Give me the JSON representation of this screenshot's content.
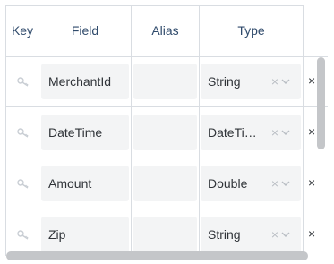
{
  "header": {
    "key": "Key",
    "field": "Field",
    "alias": "Alias",
    "type": "Type"
  },
  "rows": [
    {
      "field": "MerchantId",
      "alias": "",
      "type": "String"
    },
    {
      "field": "DateTime",
      "alias": "",
      "type": "DateTi…"
    },
    {
      "field": "Amount",
      "alias": "",
      "type": "Double"
    },
    {
      "field": "Zip",
      "alias": "",
      "type": "String"
    }
  ],
  "icons": {
    "key": "key-icon",
    "clear": "×",
    "dropdown": "chevron-down-icon",
    "delete": "×"
  },
  "colors": {
    "header_text": "#2f4a6b",
    "border": "#d9dde2",
    "cell_bg": "#f3f4f5",
    "scrollbar": "#c4c6c9"
  }
}
